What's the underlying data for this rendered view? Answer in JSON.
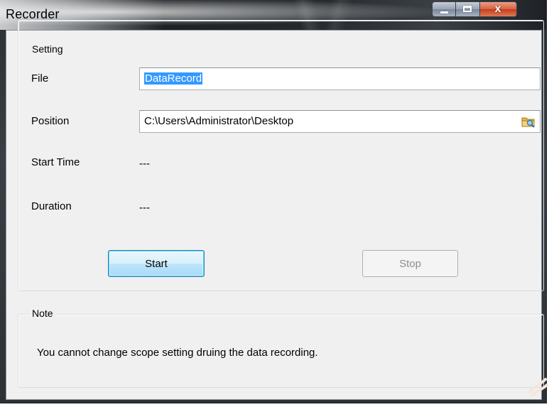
{
  "window": {
    "title": "Recorder",
    "controls": {
      "minimize": "minimize-icon",
      "maximize": "maximize-icon",
      "close": "close-icon",
      "close_glyph": "x"
    }
  },
  "setting": {
    "group_title": "Setting",
    "file_label": "File",
    "file_value": "DataRecord",
    "position_label": "Position",
    "position_value": "C:\\Users\\Administrator\\Desktop",
    "browse_icon": "folder-browse-icon",
    "start_time_label": "Start Time",
    "start_time_value": "---",
    "duration_label": "Duration",
    "duration_value": "---",
    "start_button": "Start",
    "stop_button": "Stop"
  },
  "note": {
    "group_title": "Note",
    "message": "You cannot change scope setting druing the data recording."
  },
  "colors": {
    "selection": "#3399ff",
    "client_bg": "#f0f0f0",
    "close_button": "#c9432a"
  }
}
